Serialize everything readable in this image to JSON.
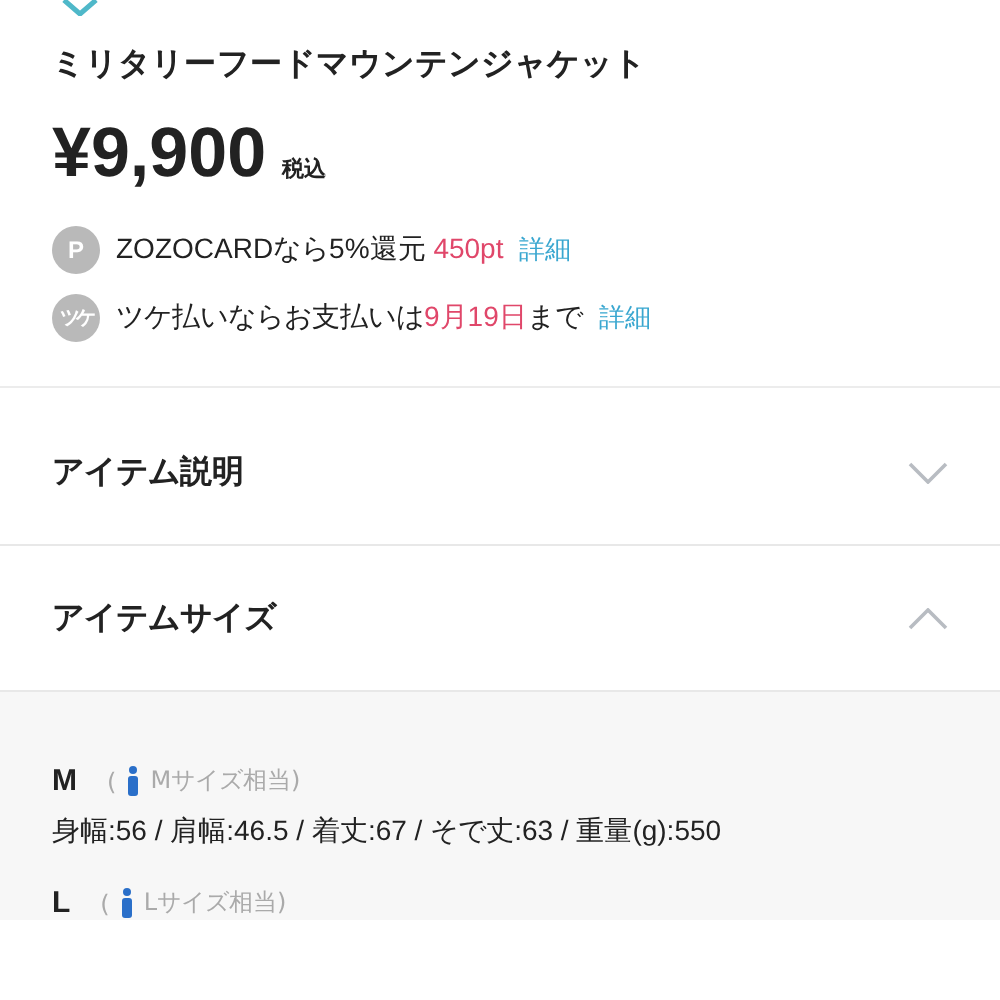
{
  "product": {
    "title": "ミリタリーフードマウンテンジャケット",
    "price": "¥9,900",
    "tax_note": "税込"
  },
  "offers": [
    {
      "kind": "points",
      "icon_text": "P",
      "segments": [
        {
          "text": "ZOZOCARDなら5%還元 ",
          "kind": "plain"
        },
        {
          "text": "450pt",
          "kind": "accent"
        }
      ],
      "link": "詳細"
    },
    {
      "kind": "deferred",
      "icon_text": "ツケ",
      "segments": [
        {
          "text": "ツケ払いならお支払いは",
          "kind": "plain"
        },
        {
          "text": "9月19日",
          "kind": "accent"
        },
        {
          "text": "まで",
          "kind": "plain"
        }
      ],
      "link": "詳細"
    }
  ],
  "sections": [
    {
      "title": "アイテム説明",
      "expanded": false
    },
    {
      "title": "アイテムサイズ",
      "expanded": true
    }
  ],
  "sizes": [
    {
      "size": "M",
      "equivalent": "Mサイズ相当)",
      "open_paren": "(",
      "measurements": "身幅:56 / 肩幅:46.5 / 着丈:67 / そで丈:63 / 重量(g):550"
    },
    {
      "size": "L",
      "equivalent": "Lサイズ相当)",
      "open_paren": "("
    }
  ]
}
